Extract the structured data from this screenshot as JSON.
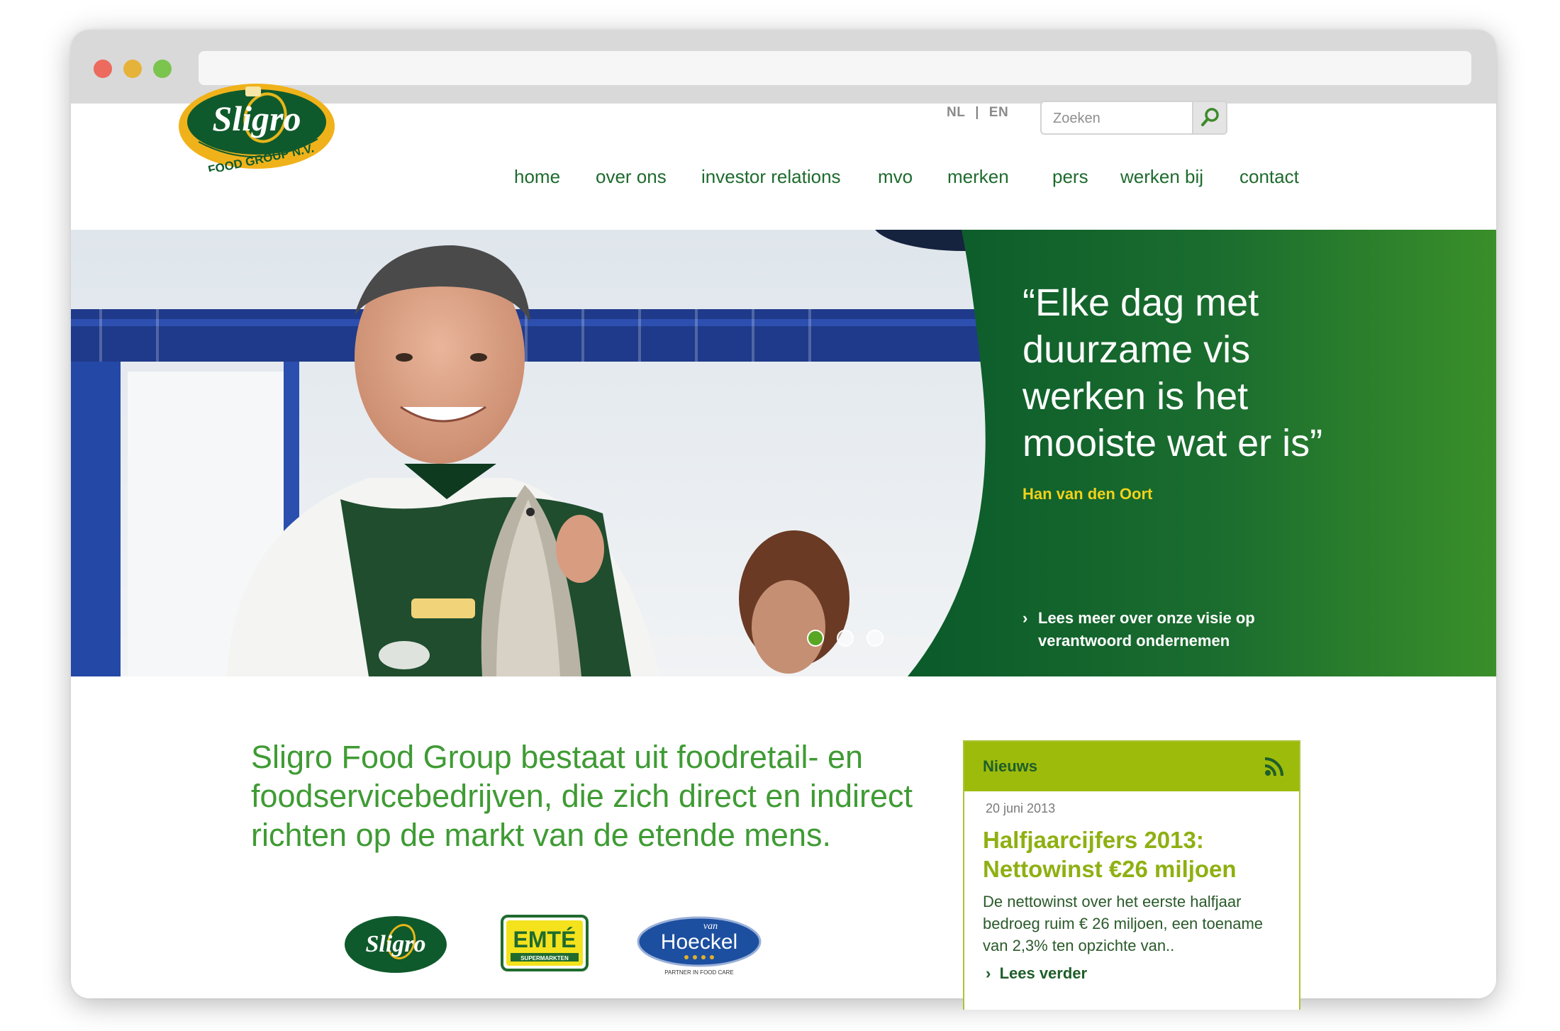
{
  "lang": {
    "nl": "NL",
    "en": "EN",
    "separator": "|"
  },
  "search": {
    "placeholder": "Zoeken"
  },
  "nav": {
    "items": [
      {
        "label": "home"
      },
      {
        "label": "over ons"
      },
      {
        "label": "investor relations"
      },
      {
        "label": "mvo"
      },
      {
        "label": "merken"
      },
      {
        "label": "pers"
      },
      {
        "label": "werken bij"
      },
      {
        "label": "contact"
      }
    ]
  },
  "logo": {
    "name": "Sligro",
    "tagline": "FOOD GROUP N.V."
  },
  "hero": {
    "quote_lines": [
      "“Elke dag met",
      "duurzame vis",
      "werken is het",
      "mooiste wat er is”"
    ],
    "author": "Han van den Oort",
    "link": "Lees meer over onze visie op verantwoord ondernemen",
    "slides": 3,
    "active_slide": 1
  },
  "intro": {
    "text": "Sligro Food Group bestaat uit foodretail- en foodservicebedrijven, die zich direct en indirect richten op de markt van de etende mens."
  },
  "brands": [
    {
      "name": "Sligro"
    },
    {
      "name": "EMTÉ",
      "sub": "SUPERMARKTEN"
    },
    {
      "name": "Hoeckel",
      "prefix": "van",
      "sub": "PARTNER IN FOOD CARE"
    }
  ],
  "news": {
    "title": "Nieuws",
    "date": "20 juni 2013",
    "headline": "Halfjaarcijfers 2013: Nettowinst €26 miljoen",
    "text": "De nettowinst over het eerste halfjaar bedroeg ruim € 26 miljoen, een toename van 2,3% ten opzichte van..",
    "more": "Lees verder"
  },
  "colors": {
    "brand_green": "#1e6b2e",
    "hero_green": "#2f8a2b",
    "accent_yellow": "#f2d21b",
    "news_green": "#9dbb0b"
  }
}
